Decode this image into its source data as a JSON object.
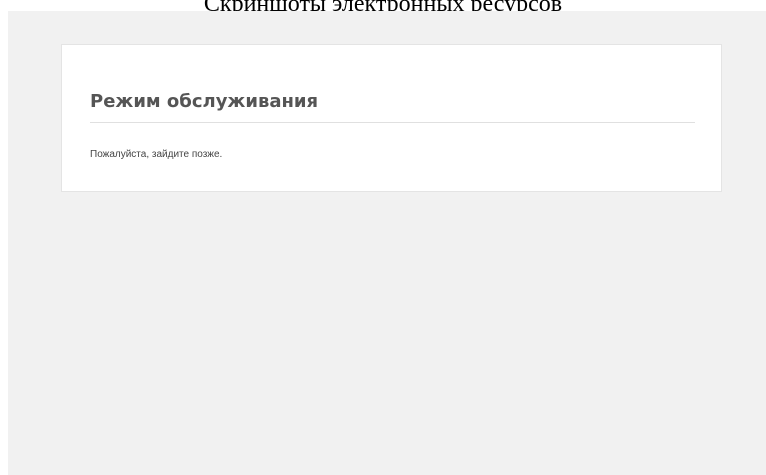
{
  "document": {
    "caption": "Скриншоты электронных ресурсов"
  },
  "maintenance": {
    "title": "Режим обслуживания",
    "message": "Пожалуйста, зайдите позже."
  }
}
